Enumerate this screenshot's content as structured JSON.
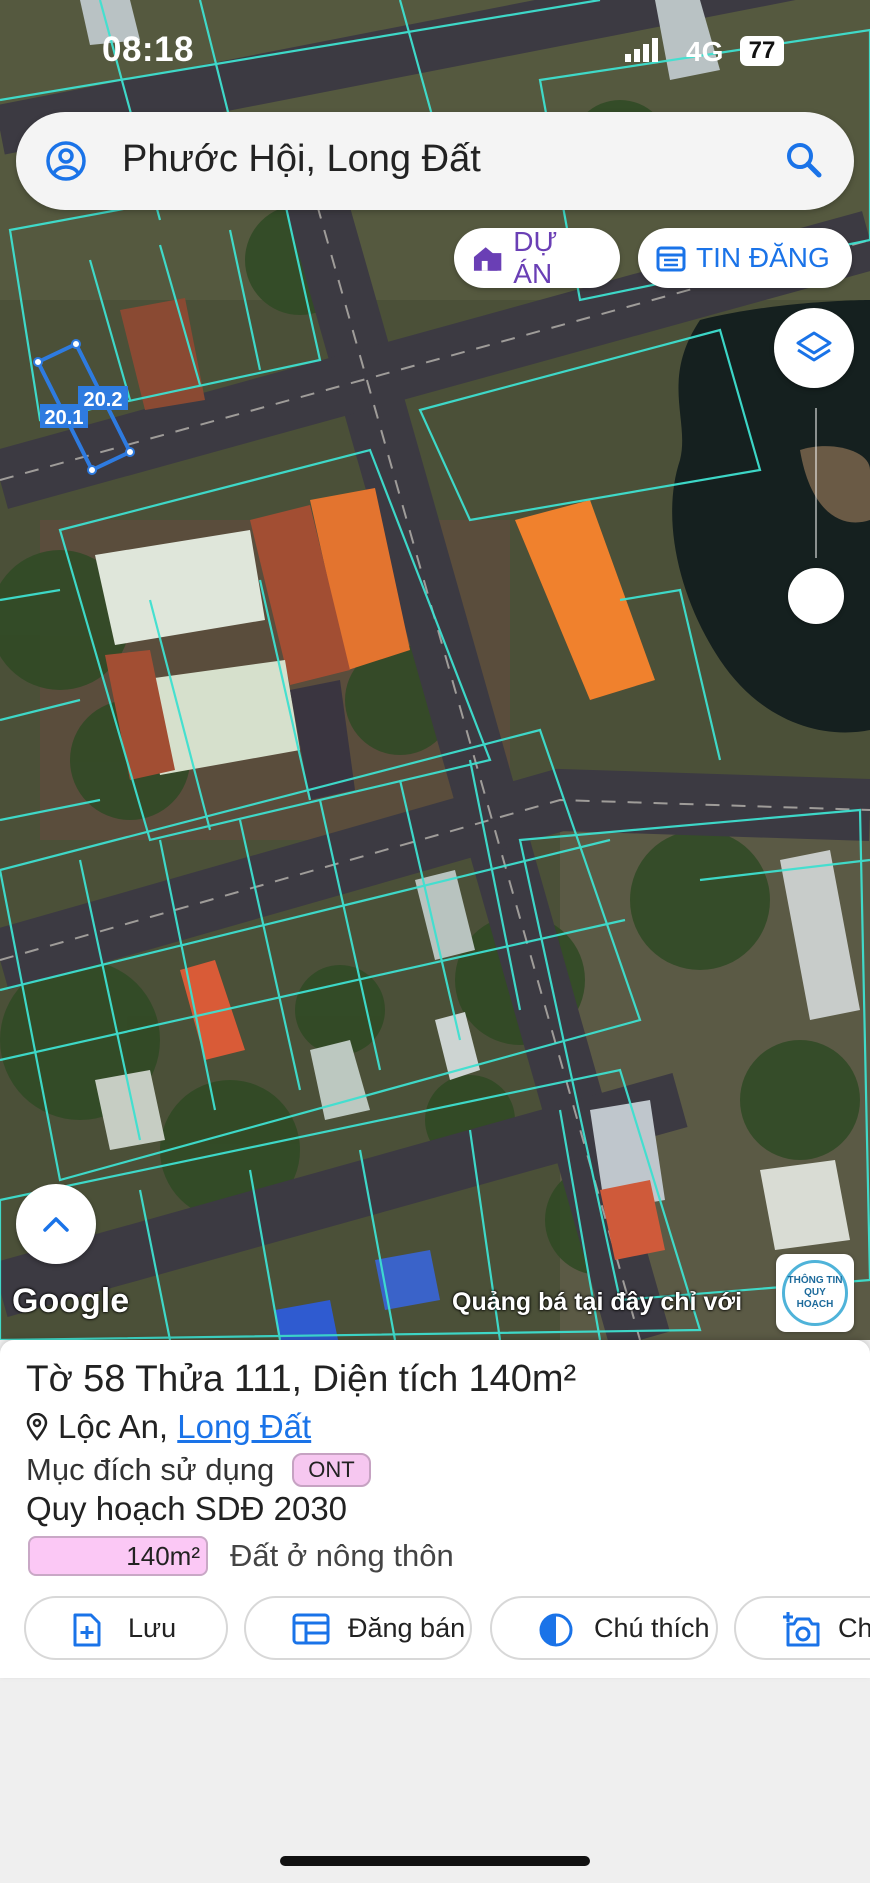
{
  "status_bar": {
    "time": "08:18",
    "network": "4G",
    "battery": "77"
  },
  "search": {
    "query": "Phước Hội, Long Đất"
  },
  "chips": {
    "du_an": "DỰ ÁN",
    "tin_dang": "TIN ĐĂNG"
  },
  "map": {
    "parcel_label_1": "20.2",
    "parcel_label_2": "20.1",
    "attribution": "Google",
    "ad_text": "Quảng bá tại đây chỉ với",
    "badge_line1": "THÔNG TIN",
    "badge_line2": "QUY HOẠCH"
  },
  "parcel": {
    "sheet_label": "Tờ",
    "sheet_no": "58",
    "plot_label": "Thửa",
    "plot_no": "111",
    "area_label": ", Diện tích",
    "area": "140m²",
    "location_prefix": "Lộc An,",
    "location_link": "Long Đất",
    "purpose_label": "Mục đích sử dụng",
    "purpose_code": "ONT",
    "plan_label": "Quy hoạch SDĐ 2030",
    "plan_area": "140m²",
    "plan_type": "Đất ở nông thôn"
  },
  "actions": [
    {
      "label": "Lưu"
    },
    {
      "label": "Đăng bán"
    },
    {
      "label": "Chú thích"
    },
    {
      "label": "Chụp"
    }
  ],
  "colors": {
    "accent_blue": "#1a73e8",
    "accent_purple": "#6a3fb5",
    "parcel_line": "#3ee0d0",
    "land_pink": "#fbc8f5"
  }
}
